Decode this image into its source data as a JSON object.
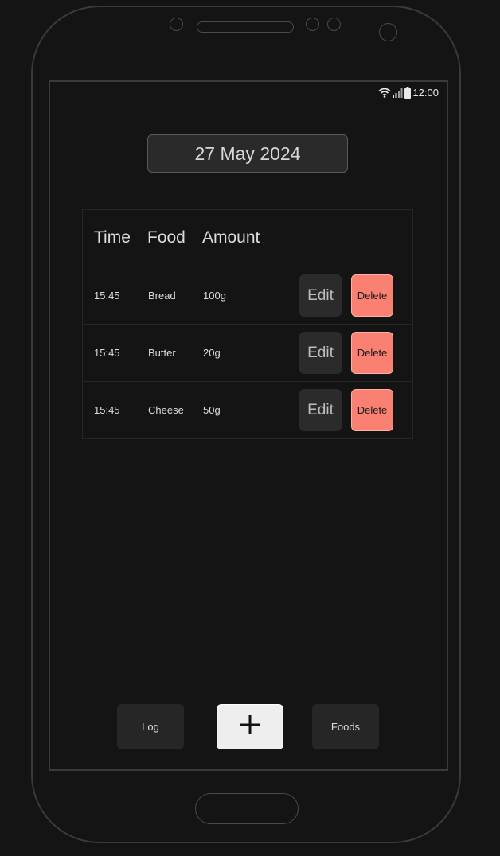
{
  "status_bar": {
    "time": "12:00",
    "icons": [
      "wifi-icon",
      "signal-icon",
      "battery-icon"
    ]
  },
  "date_selector": {
    "label": "27 May 2024"
  },
  "log_table": {
    "headers": [
      "Time",
      "Food",
      "Amount"
    ],
    "rows": [
      {
        "time": "15:45",
        "food": "Bread",
        "amount": "100g",
        "edit_label": "Edit",
        "delete_label": "Delete"
      },
      {
        "time": "15:45",
        "food": "Butter",
        "amount": "20g",
        "edit_label": "Edit",
        "delete_label": "Delete"
      },
      {
        "time": "15:45",
        "food": "Cheese",
        "amount": "50g",
        "edit_label": "Edit",
        "delete_label": "Delete"
      }
    ]
  },
  "bottom_nav": {
    "log_label": "Log",
    "add_icon": "plus-icon",
    "foods_label": "Foods"
  },
  "colors": {
    "background": "#141414",
    "delete_accent": "#fa8072",
    "add_button": "#eeeeee"
  }
}
